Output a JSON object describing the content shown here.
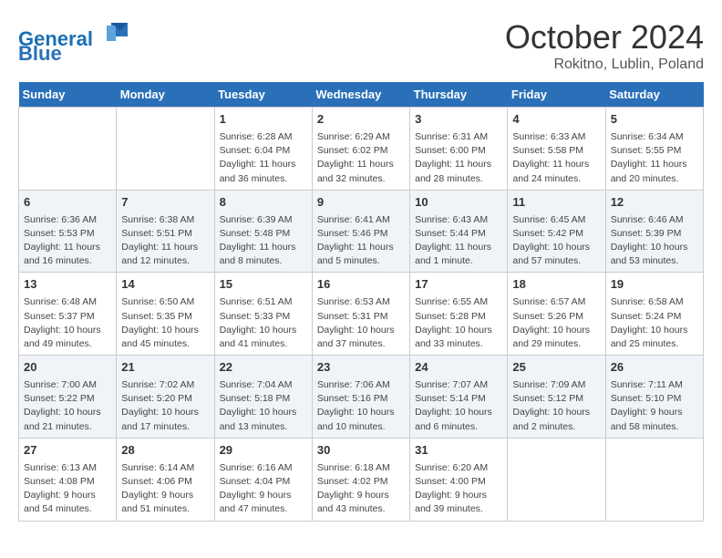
{
  "header": {
    "logo_line1": "General",
    "logo_line2": "Blue",
    "month": "October 2024",
    "location": "Rokitno, Lublin, Poland"
  },
  "days_of_week": [
    "Sunday",
    "Monday",
    "Tuesday",
    "Wednesday",
    "Thursday",
    "Friday",
    "Saturday"
  ],
  "weeks": [
    [
      {
        "day": "",
        "content": ""
      },
      {
        "day": "",
        "content": ""
      },
      {
        "day": "1",
        "content": "Sunrise: 6:28 AM\nSunset: 6:04 PM\nDaylight: 11 hours\nand 36 minutes."
      },
      {
        "day": "2",
        "content": "Sunrise: 6:29 AM\nSunset: 6:02 PM\nDaylight: 11 hours\nand 32 minutes."
      },
      {
        "day": "3",
        "content": "Sunrise: 6:31 AM\nSunset: 6:00 PM\nDaylight: 11 hours\nand 28 minutes."
      },
      {
        "day": "4",
        "content": "Sunrise: 6:33 AM\nSunset: 5:58 PM\nDaylight: 11 hours\nand 24 minutes."
      },
      {
        "day": "5",
        "content": "Sunrise: 6:34 AM\nSunset: 5:55 PM\nDaylight: 11 hours\nand 20 minutes."
      }
    ],
    [
      {
        "day": "6",
        "content": "Sunrise: 6:36 AM\nSunset: 5:53 PM\nDaylight: 11 hours\nand 16 minutes."
      },
      {
        "day": "7",
        "content": "Sunrise: 6:38 AM\nSunset: 5:51 PM\nDaylight: 11 hours\nand 12 minutes."
      },
      {
        "day": "8",
        "content": "Sunrise: 6:39 AM\nSunset: 5:48 PM\nDaylight: 11 hours\nand 8 minutes."
      },
      {
        "day": "9",
        "content": "Sunrise: 6:41 AM\nSunset: 5:46 PM\nDaylight: 11 hours\nand 5 minutes."
      },
      {
        "day": "10",
        "content": "Sunrise: 6:43 AM\nSunset: 5:44 PM\nDaylight: 11 hours\nand 1 minute."
      },
      {
        "day": "11",
        "content": "Sunrise: 6:45 AM\nSunset: 5:42 PM\nDaylight: 10 hours\nand 57 minutes."
      },
      {
        "day": "12",
        "content": "Sunrise: 6:46 AM\nSunset: 5:39 PM\nDaylight: 10 hours\nand 53 minutes."
      }
    ],
    [
      {
        "day": "13",
        "content": "Sunrise: 6:48 AM\nSunset: 5:37 PM\nDaylight: 10 hours\nand 49 minutes."
      },
      {
        "day": "14",
        "content": "Sunrise: 6:50 AM\nSunset: 5:35 PM\nDaylight: 10 hours\nand 45 minutes."
      },
      {
        "day": "15",
        "content": "Sunrise: 6:51 AM\nSunset: 5:33 PM\nDaylight: 10 hours\nand 41 minutes."
      },
      {
        "day": "16",
        "content": "Sunrise: 6:53 AM\nSunset: 5:31 PM\nDaylight: 10 hours\nand 37 minutes."
      },
      {
        "day": "17",
        "content": "Sunrise: 6:55 AM\nSunset: 5:28 PM\nDaylight: 10 hours\nand 33 minutes."
      },
      {
        "day": "18",
        "content": "Sunrise: 6:57 AM\nSunset: 5:26 PM\nDaylight: 10 hours\nand 29 minutes."
      },
      {
        "day": "19",
        "content": "Sunrise: 6:58 AM\nSunset: 5:24 PM\nDaylight: 10 hours\nand 25 minutes."
      }
    ],
    [
      {
        "day": "20",
        "content": "Sunrise: 7:00 AM\nSunset: 5:22 PM\nDaylight: 10 hours\nand 21 minutes."
      },
      {
        "day": "21",
        "content": "Sunrise: 7:02 AM\nSunset: 5:20 PM\nDaylight: 10 hours\nand 17 minutes."
      },
      {
        "day": "22",
        "content": "Sunrise: 7:04 AM\nSunset: 5:18 PM\nDaylight: 10 hours\nand 13 minutes."
      },
      {
        "day": "23",
        "content": "Sunrise: 7:06 AM\nSunset: 5:16 PM\nDaylight: 10 hours\nand 10 minutes."
      },
      {
        "day": "24",
        "content": "Sunrise: 7:07 AM\nSunset: 5:14 PM\nDaylight: 10 hours\nand 6 minutes."
      },
      {
        "day": "25",
        "content": "Sunrise: 7:09 AM\nSunset: 5:12 PM\nDaylight: 10 hours\nand 2 minutes."
      },
      {
        "day": "26",
        "content": "Sunrise: 7:11 AM\nSunset: 5:10 PM\nDaylight: 9 hours\nand 58 minutes."
      }
    ],
    [
      {
        "day": "27",
        "content": "Sunrise: 6:13 AM\nSunset: 4:08 PM\nDaylight: 9 hours\nand 54 minutes."
      },
      {
        "day": "28",
        "content": "Sunrise: 6:14 AM\nSunset: 4:06 PM\nDaylight: 9 hours\nand 51 minutes."
      },
      {
        "day": "29",
        "content": "Sunrise: 6:16 AM\nSunset: 4:04 PM\nDaylight: 9 hours\nand 47 minutes."
      },
      {
        "day": "30",
        "content": "Sunrise: 6:18 AM\nSunset: 4:02 PM\nDaylight: 9 hours\nand 43 minutes."
      },
      {
        "day": "31",
        "content": "Sunrise: 6:20 AM\nSunset: 4:00 PM\nDaylight: 9 hours\nand 39 minutes."
      },
      {
        "day": "",
        "content": ""
      },
      {
        "day": "",
        "content": ""
      }
    ]
  ]
}
